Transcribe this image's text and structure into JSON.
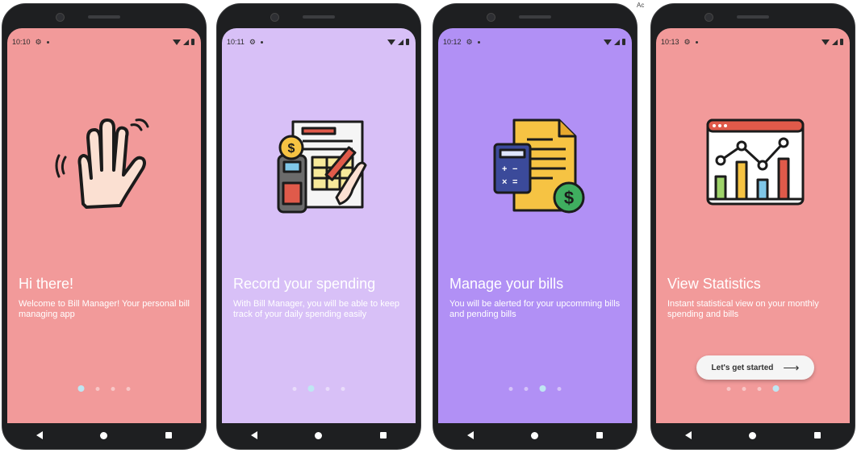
{
  "screens": [
    {
      "time": "10:10",
      "bg": "#f29a9a",
      "title": "Hi there!",
      "description": "Welcome to Bill Manager! Your personal bill managing app",
      "illustration": "waving-hand",
      "active_dot": 0
    },
    {
      "time": "10:11",
      "bg": "#d8c0f7",
      "title": "Record your spending",
      "description": "With Bill Manager, you will be able to keep track of your daily spending easily",
      "illustration": "receipt-calculator",
      "active_dot": 1
    },
    {
      "time": "10:12",
      "bg": "#b190f5",
      "title": "Manage your bills",
      "description": "You will be alerted for your upcomming bills and pending bills",
      "illustration": "bill-document",
      "active_dot": 2
    },
    {
      "time": "10:13",
      "bg": "#f29a9a",
      "title": "View Statistics",
      "description": "Instant statistical view on your monthly spending and bills",
      "illustration": "statistics-chart",
      "active_dot": 3,
      "cta_label": "Let's get started"
    }
  ],
  "corner_label": "Ac"
}
